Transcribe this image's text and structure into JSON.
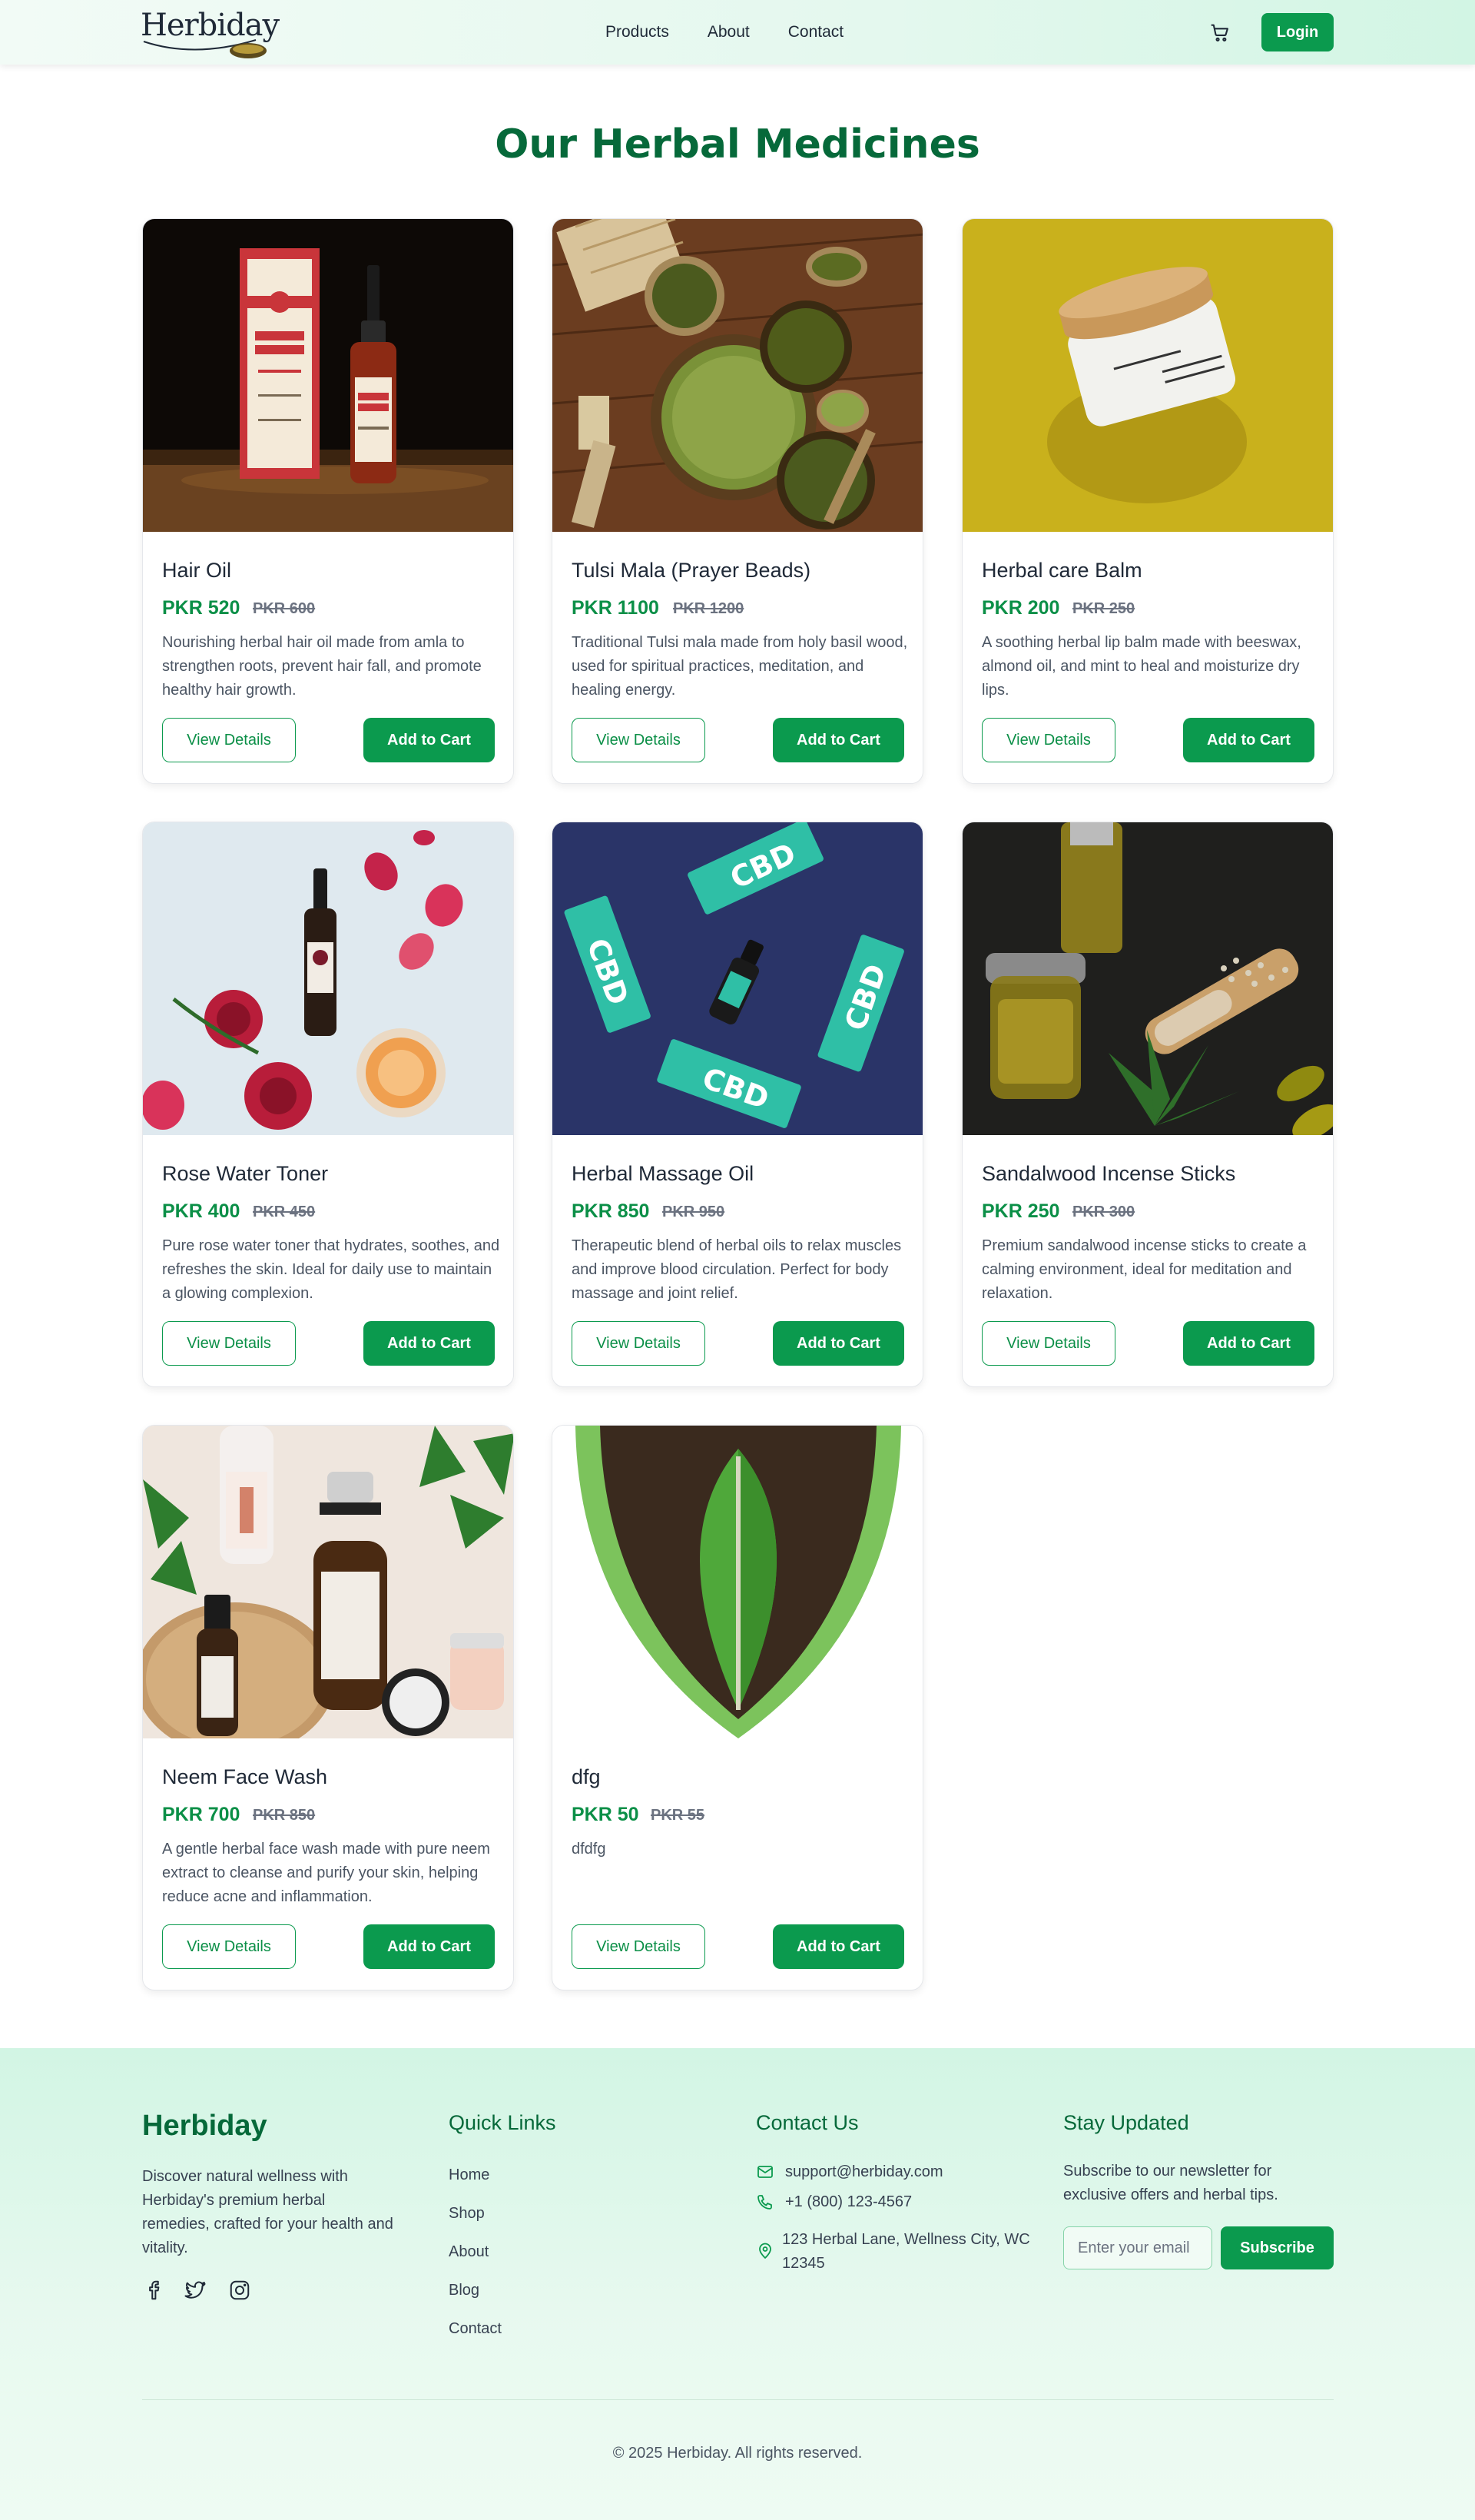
{
  "header": {
    "logo": "Herbiday",
    "nav": [
      "Products",
      "About",
      "Contact"
    ],
    "cart_icon": "cart-icon",
    "login_label": "Login"
  },
  "page": {
    "title": "Our Herbal Medicines"
  },
  "products": [
    {
      "name": "Hair Oil",
      "price": "PKR 520",
      "old_price": "PKR 600",
      "description": "Nourishing herbal hair oil made from amla to strengthen roots, prevent hair fall, and promote healthy hair growth."
    },
    {
      "name": "Tulsi Mala (Prayer Beads)",
      "price": "PKR 1100",
      "old_price": "PKR 1200",
      "description": "Traditional Tulsi mala made from holy basil wood, used for spiritual practices, meditation, and healing energy."
    },
    {
      "name": "Herbal care Balm",
      "price": "PKR 200",
      "old_price": "PKR 250",
      "description": "A soothing herbal lip balm made with beeswax, almond oil, and mint to heal and moisturize dry lips."
    },
    {
      "name": "Rose Water Toner",
      "price": "PKR 400",
      "old_price": "PKR 450",
      "description": "Pure rose water toner that hydrates, soothes, and refreshes the skin. Ideal for daily use to maintain a glowing complexion."
    },
    {
      "name": "Herbal Massage Oil",
      "price": "PKR 850",
      "old_price": "PKR 950",
      "description": "Therapeutic blend of herbal oils to relax muscles and improve blood circulation. Perfect for body massage and joint relief."
    },
    {
      "name": "Sandalwood Incense Sticks",
      "price": "PKR 250",
      "old_price": "PKR 300",
      "description": "Premium sandalwood incense sticks to create a calming environment, ideal for meditation and relaxation."
    },
    {
      "name": "Neem Face Wash",
      "price": "PKR 700",
      "old_price": "PKR 850",
      "description": "A gentle herbal face wash made with pure neem extract to cleanse and purify your skin, helping reduce acne and inflammation."
    },
    {
      "name": "dfg",
      "price": "PKR 50",
      "old_price": "PKR 55",
      "description": "dfdfg"
    }
  ],
  "buttons": {
    "details": "View Details",
    "cart": "Add to Cart"
  },
  "footer": {
    "brand": "Herbiday",
    "about": "Discover natural wellness with Herbiday's premium herbal remedies, crafted for your health and vitality.",
    "social_icons": [
      "facebook-icon",
      "twitter-icon",
      "instagram-icon"
    ],
    "quick_links_heading": "Quick Links",
    "quick_links": [
      "Home",
      "Shop",
      "About",
      "Blog",
      "Contact"
    ],
    "contact_heading": "Contact Us",
    "email": "support@herbiday.com",
    "phone": "+1 (800) 123-4567",
    "address": "123 Herbal Lane, Wellness City, WC 12345",
    "newsletter_heading": "Stay Updated",
    "newsletter_text": "Subscribe to our newsletter for exclusive offers and herbal tips.",
    "email_placeholder": "Enter your email",
    "subscribe_label": "Subscribe",
    "copyright": "© 2025 Herbiday. All rights reserved."
  }
}
